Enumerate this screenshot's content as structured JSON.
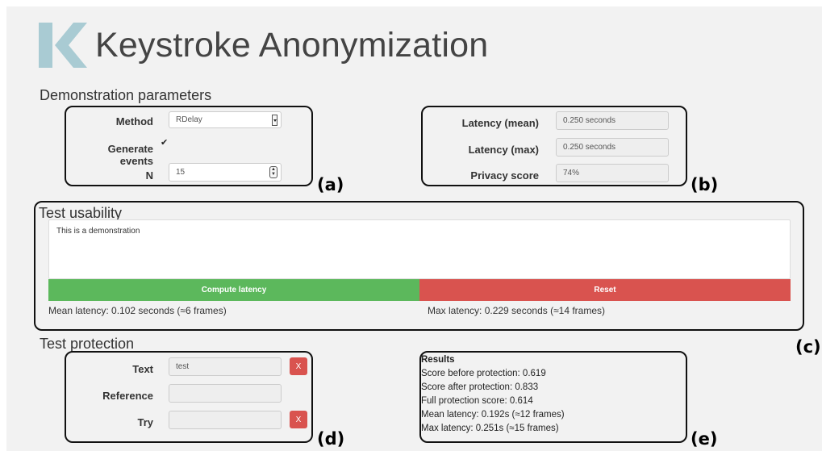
{
  "app": {
    "title": "Keystroke Anonymization"
  },
  "params": {
    "section_title": "Demonstration parameters",
    "method_label": "Method",
    "method_value": "RDelay",
    "generate_label": "Generate events",
    "generate_checked": true,
    "n_label": "N",
    "n_value": "15",
    "box_label": "(a)"
  },
  "metrics": {
    "latency_mean_label": "Latency (mean)",
    "latency_mean_value": "0.250 seconds",
    "latency_max_label": "Latency (max)",
    "latency_max_value": "0.250 seconds",
    "privacy_label": "Privacy score",
    "privacy_value": "74%",
    "box_label": "(b)"
  },
  "usability": {
    "section_title": "Test usability",
    "text": "This is a demonstration",
    "compute_button": "Compute latency",
    "reset_button": "Reset",
    "mean_latency": "Mean latency: 0.102 seconds (≈6 frames)",
    "max_latency": "Max latency: 0.229 seconds (≈14 frames)",
    "box_label": "(c)"
  },
  "protection": {
    "section_title": "Test protection",
    "text_label": "Text",
    "text_value": "test",
    "reference_label": "Reference",
    "reference_value": "",
    "try_label": "Try",
    "try_value": "",
    "clear_button": "X",
    "box_label": "(d)"
  },
  "results": {
    "heading": "Results",
    "lines": [
      "Score before protection: 0.619",
      "Score after protection: 0.833",
      "Full protection score: 0.614",
      "Mean latency: 0.192s (≈12 frames)",
      "Max latency: 0.251s (≈15 frames)"
    ],
    "box_label": "(e)"
  },
  "colors": {
    "logo": "#a9cbd3",
    "green": "#5cb85c",
    "red": "#d9534f"
  }
}
